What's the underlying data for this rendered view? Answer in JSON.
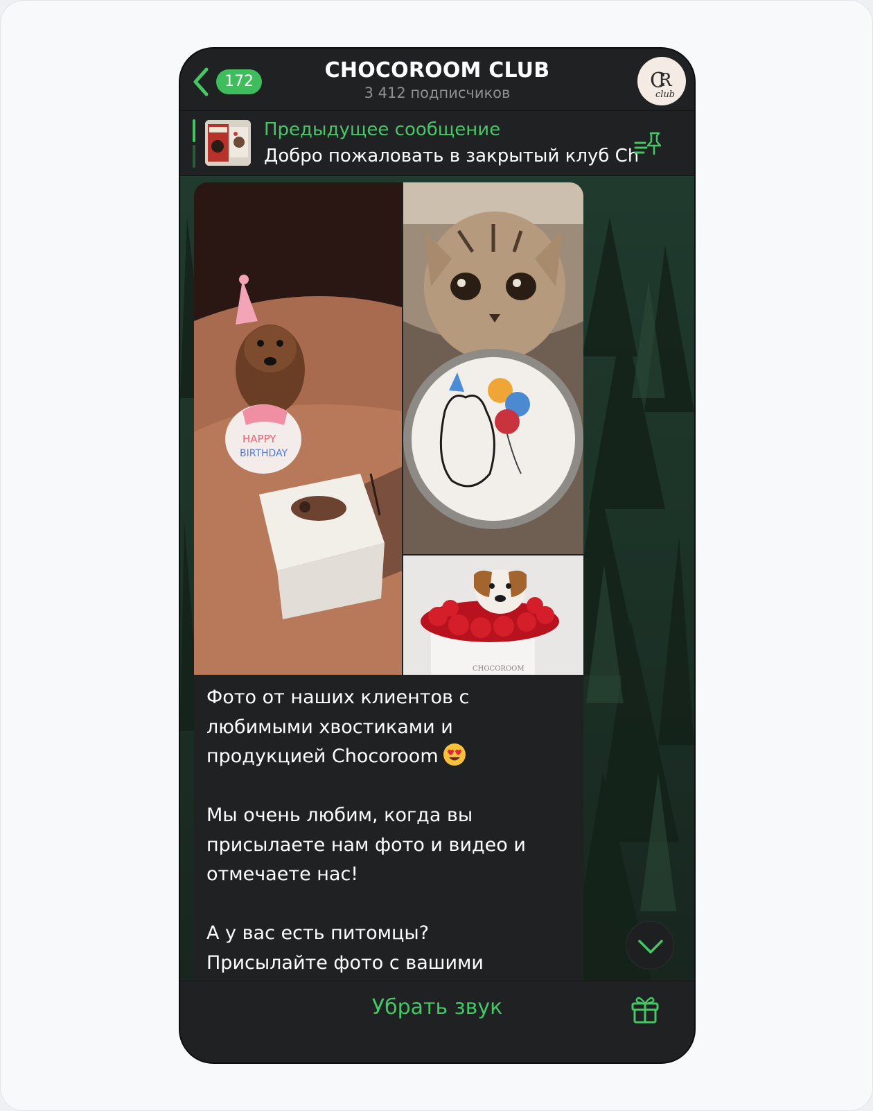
{
  "header": {
    "back_badge": "172",
    "title": "CHOCOROOM CLUB",
    "subtitle": "3 412 подписчиков",
    "avatar_icon": "channel-avatar-cr-club"
  },
  "pinned": {
    "label": "Предыдущее сообщение",
    "text": "Добро пожаловать в закрытый клуб Ch..."
  },
  "message": {
    "photos": [
      "dog-birthday-cake-photo",
      "cat-bento-cake-photo",
      "dog-roses-box-photo"
    ],
    "paragraph1_line1": "Фото от наших клиентов с",
    "paragraph1_line2": "любимыми хвостиками и",
    "paragraph1_line3": "продукцией Chocoroom",
    "paragraph2_line1": "Мы очень любим, когда вы",
    "paragraph2_line2": "присылаете нам фото и видео и",
    "paragraph2_line3": "отмечаете нас!",
    "paragraph3_line1": "А у вас есть питомцы?",
    "paragraph3_line2": "Присылайте фото с вашими"
  },
  "bottom": {
    "mute_label": "Убрать звук"
  },
  "colors": {
    "accent": "#46c766",
    "badge": "#3fbd5c",
    "panel": "#1f2122"
  }
}
